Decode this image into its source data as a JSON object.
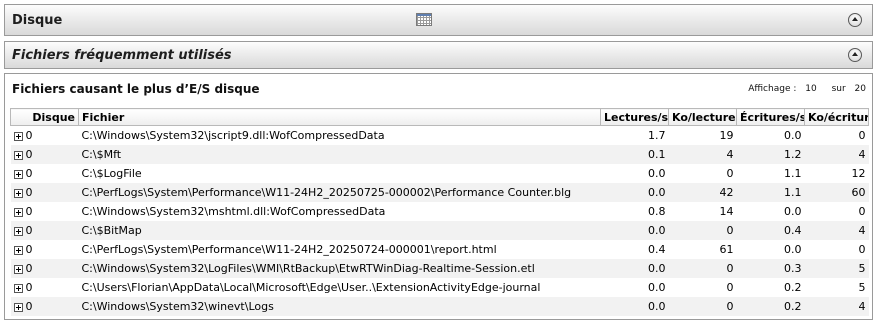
{
  "sections": {
    "disque": {
      "title": "Disque"
    },
    "fichiers": {
      "title": "Fichiers fréquemment utilisés"
    }
  },
  "panel": {
    "title": "Fichiers causant le plus d’E/S disque",
    "affichage_label": "Affichage :",
    "affichage_value": "10",
    "sur_label": "sur",
    "sur_value": "20"
  },
  "table": {
    "columns": [
      "Disque",
      "Fichier",
      "Lectures/s",
      "Ko/lecture",
      "Écritures/s",
      "Ko/écriture"
    ],
    "rows": [
      {
        "disk": "0",
        "file": "C:\\Windows\\System32\\jscript9.dll:WofCompressedData",
        "reads": "1.7",
        "kb_read": "19",
        "writes": "0.0",
        "kb_write": "0"
      },
      {
        "disk": "0",
        "file": "C:\\$Mft",
        "reads": "0.1",
        "kb_read": "4",
        "writes": "1.2",
        "kb_write": "4"
      },
      {
        "disk": "0",
        "file": "C:\\$LogFile",
        "reads": "0.0",
        "kb_read": "0",
        "writes": "1.1",
        "kb_write": "12"
      },
      {
        "disk": "0",
        "file": "C:\\PerfLogs\\System\\Performance\\W11-24H2_20250725-000002\\Performance Counter.blg",
        "reads": "0.0",
        "kb_read": "42",
        "writes": "1.1",
        "kb_write": "60"
      },
      {
        "disk": "0",
        "file": "C:\\Windows\\System32\\mshtml.dll:WofCompressedData",
        "reads": "0.8",
        "kb_read": "14",
        "writes": "0.0",
        "kb_write": "0"
      },
      {
        "disk": "0",
        "file": "C:\\$BitMap",
        "reads": "0.0",
        "kb_read": "0",
        "writes": "0.4",
        "kb_write": "4"
      },
      {
        "disk": "0",
        "file": "C:\\PerfLogs\\System\\Performance\\W11-24H2_20250724-000001\\report.html",
        "reads": "0.4",
        "kb_read": "61",
        "writes": "0.0",
        "kb_write": "0"
      },
      {
        "disk": "0",
        "file": "C:\\Windows\\System32\\LogFiles\\WMI\\RtBackup\\EtwRTWinDiag-Realtime-Session.etl",
        "reads": "0.0",
        "kb_read": "0",
        "writes": "0.3",
        "kb_write": "5"
      },
      {
        "disk": "0",
        "file": "C:\\Users\\Florian\\AppData\\Local\\Microsoft\\Edge\\User..\\ExtensionActivityEdge-journal",
        "reads": "0.0",
        "kb_read": "0",
        "writes": "0.2",
        "kb_write": "5"
      },
      {
        "disk": "0",
        "file": "C:\\Windows\\System32\\winevt\\Logs",
        "reads": "0.0",
        "kb_read": "0",
        "writes": "0.2",
        "kb_write": "4"
      }
    ]
  }
}
